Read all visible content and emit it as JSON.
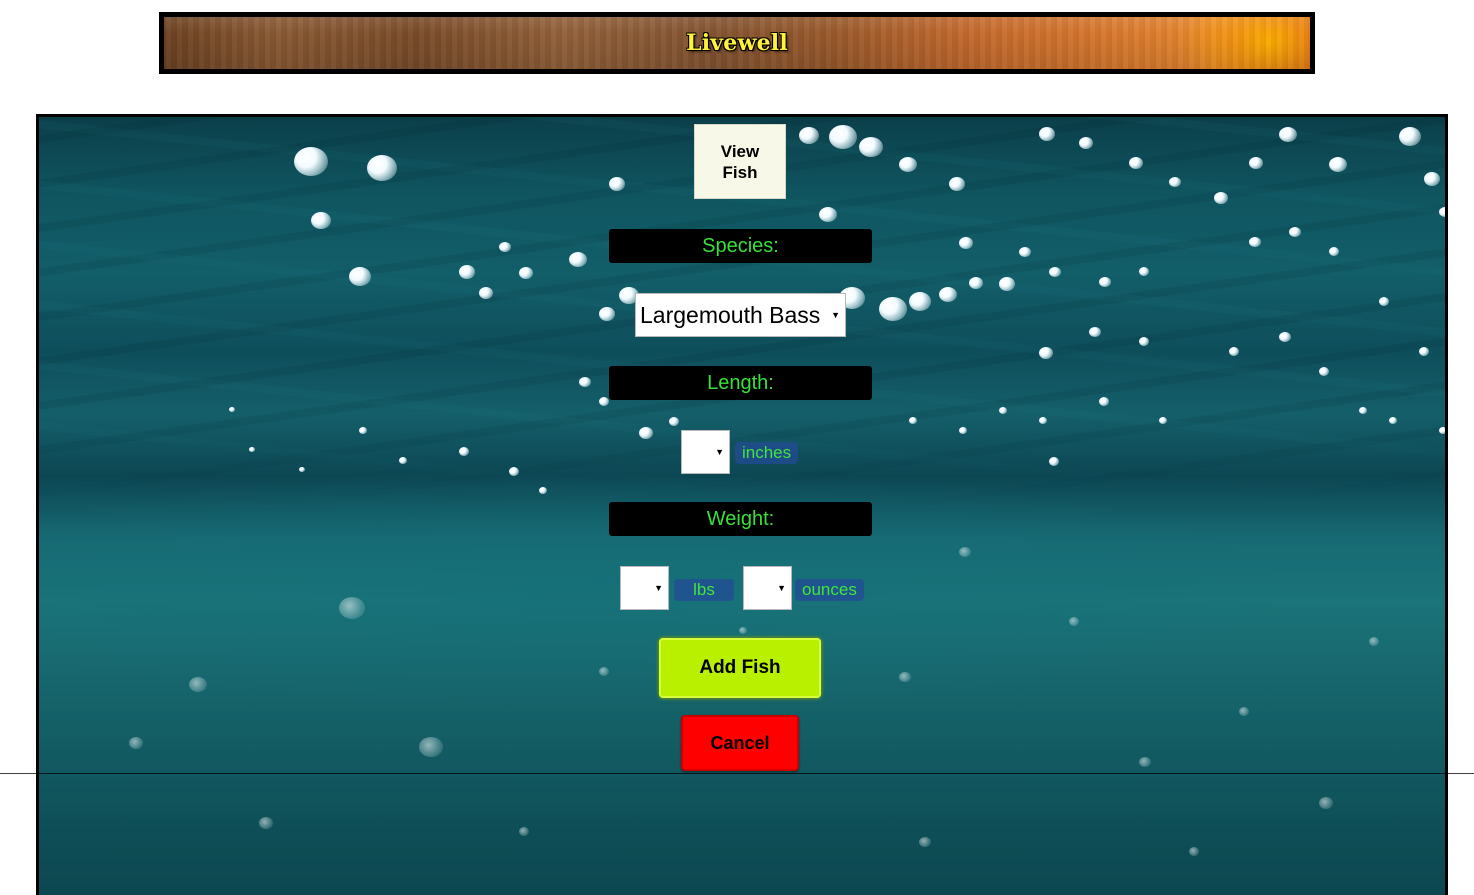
{
  "app": {
    "title": "Livewell"
  },
  "form": {
    "view_fish_label": "View\nFish",
    "species_label": "Species:",
    "species_value": "Largemouth Bass",
    "length_label": "Length:",
    "length_value": "",
    "length_unit": "inches",
    "weight_label": "Weight:",
    "weight_lbs_value": "",
    "weight_lbs_unit": "lbs",
    "weight_oz_value": "",
    "weight_oz_unit": "ounces",
    "add_label": "Add Fish",
    "cancel_label": "Cancel"
  },
  "icons": {
    "dropdown": "caret-down-icon"
  },
  "colors": {
    "label_text": "#39e03a",
    "add_button": "#b9f000",
    "cancel_button": "#ff0000",
    "title_text": "#fff33a"
  }
}
